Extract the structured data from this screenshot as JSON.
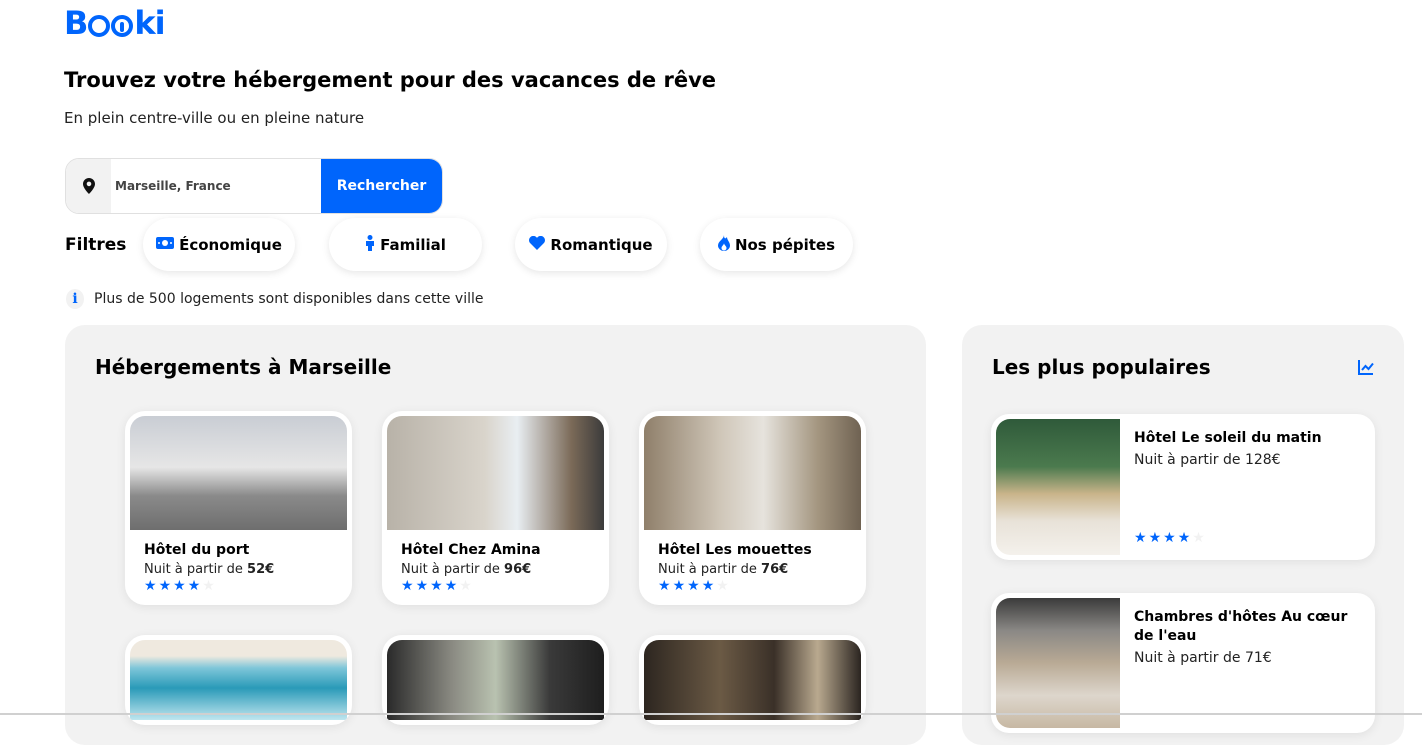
{
  "brand": {
    "logo_text": "Booki"
  },
  "hero": {
    "title": "Trouvez votre hébergement pour des vacances de rêve",
    "subtitle": "En plein centre-ville ou en pleine nature"
  },
  "search": {
    "value": "Marseille, France",
    "button_label": "Rechercher",
    "icon": "location-pin-icon"
  },
  "filters": {
    "label": "Filtres",
    "items": [
      {
        "label": "Économique",
        "icon": "money-bill-icon"
      },
      {
        "label": "Familial",
        "icon": "person-icon"
      },
      {
        "label": "Romantique",
        "icon": "heart-icon"
      },
      {
        "label": "Nos pépites",
        "icon": "fire-icon"
      }
    ]
  },
  "info": {
    "text": "Plus de 500 logements sont disponibles dans cette ville",
    "icon": "info-icon"
  },
  "accommodations": {
    "title": "Hébergements à Marseille",
    "items": [
      {
        "name": "Hôtel du port",
        "price_prefix": "Nuit à partir de ",
        "price": "52€",
        "stars": 4
      },
      {
        "name": "Hôtel Chez Amina",
        "price_prefix": "Nuit à partir de ",
        "price": "96€",
        "stars": 4
      },
      {
        "name": "Hôtel Les mouettes",
        "price_prefix": "Nuit à partir de ",
        "price": "76€",
        "stars": 4
      }
    ]
  },
  "popular": {
    "title": "Les plus populaires",
    "icon": "chart-line-icon",
    "items": [
      {
        "name": "Hôtel Le soleil du matin",
        "price": "Nuit à partir de 128€",
        "stars": 4
      },
      {
        "name": "Chambres d'hôtes Au cœur de l'eau",
        "price": "Nuit à partir de 71€",
        "stars": 4
      }
    ]
  },
  "colors": {
    "accent": "#0065fc",
    "panel_bg": "#f2f2f2"
  }
}
